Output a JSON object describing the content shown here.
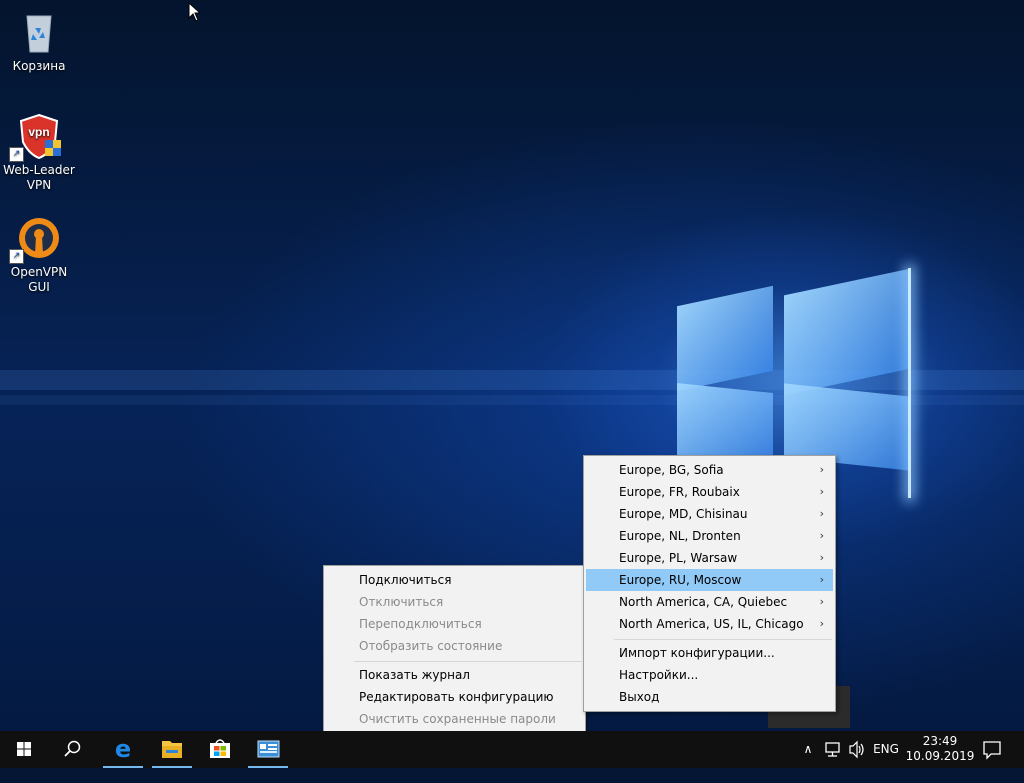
{
  "desktop": {
    "icons": [
      {
        "label": "Корзина",
        "icon": "recycle-bin-icon"
      },
      {
        "label": "Web-Leader VPN",
        "icon": "vpn-shield-icon"
      },
      {
        "label": "OpenVPN GUI",
        "icon": "openvpn-icon"
      }
    ]
  },
  "context_menu": {
    "items": [
      {
        "label": "Подключиться",
        "enabled": true
      },
      {
        "label": "Отключиться",
        "enabled": false
      },
      {
        "label": "Переподключиться",
        "enabled": false
      },
      {
        "label": "Отобразить состояние",
        "enabled": false
      },
      {
        "label": "Показать журнал",
        "enabled": true
      },
      {
        "label": "Редактировать конфигурацию",
        "enabled": true
      },
      {
        "label": "Очистить сохраненные пароли",
        "enabled": false
      }
    ]
  },
  "server_menu": {
    "servers": [
      {
        "label": "Europe, BG, Sofia"
      },
      {
        "label": "Europe, FR, Roubaix"
      },
      {
        "label": "Europe, MD, Chisinau"
      },
      {
        "label": "Europe, NL, Dronten"
      },
      {
        "label": "Europe, PL, Warsaw"
      },
      {
        "label": "Europe, RU, Moscow",
        "highlighted": true
      },
      {
        "label": "North America, CA, Quiebec"
      },
      {
        "label": "North America, US, IL, Chicago"
      }
    ],
    "import_label": "Импорт конфигурации...",
    "settings_label": "Настройки...",
    "exit_label": "Выход",
    "submenu_arrow": "›"
  },
  "taskbar": {
    "apps": [
      "start-icon",
      "search-icon",
      "edge-icon",
      "file-explorer-icon",
      "store-icon",
      "app-window-icon"
    ],
    "tray": {
      "chevron": "∧",
      "language": "ENG",
      "time": "23:49",
      "date": "10.09.2019"
    }
  },
  "colors": {
    "highlight": "#91c9f7",
    "menu_bg": "#f2f2f2",
    "disabled_text": "#8a8a8a",
    "taskbar_bg": "#101010"
  }
}
